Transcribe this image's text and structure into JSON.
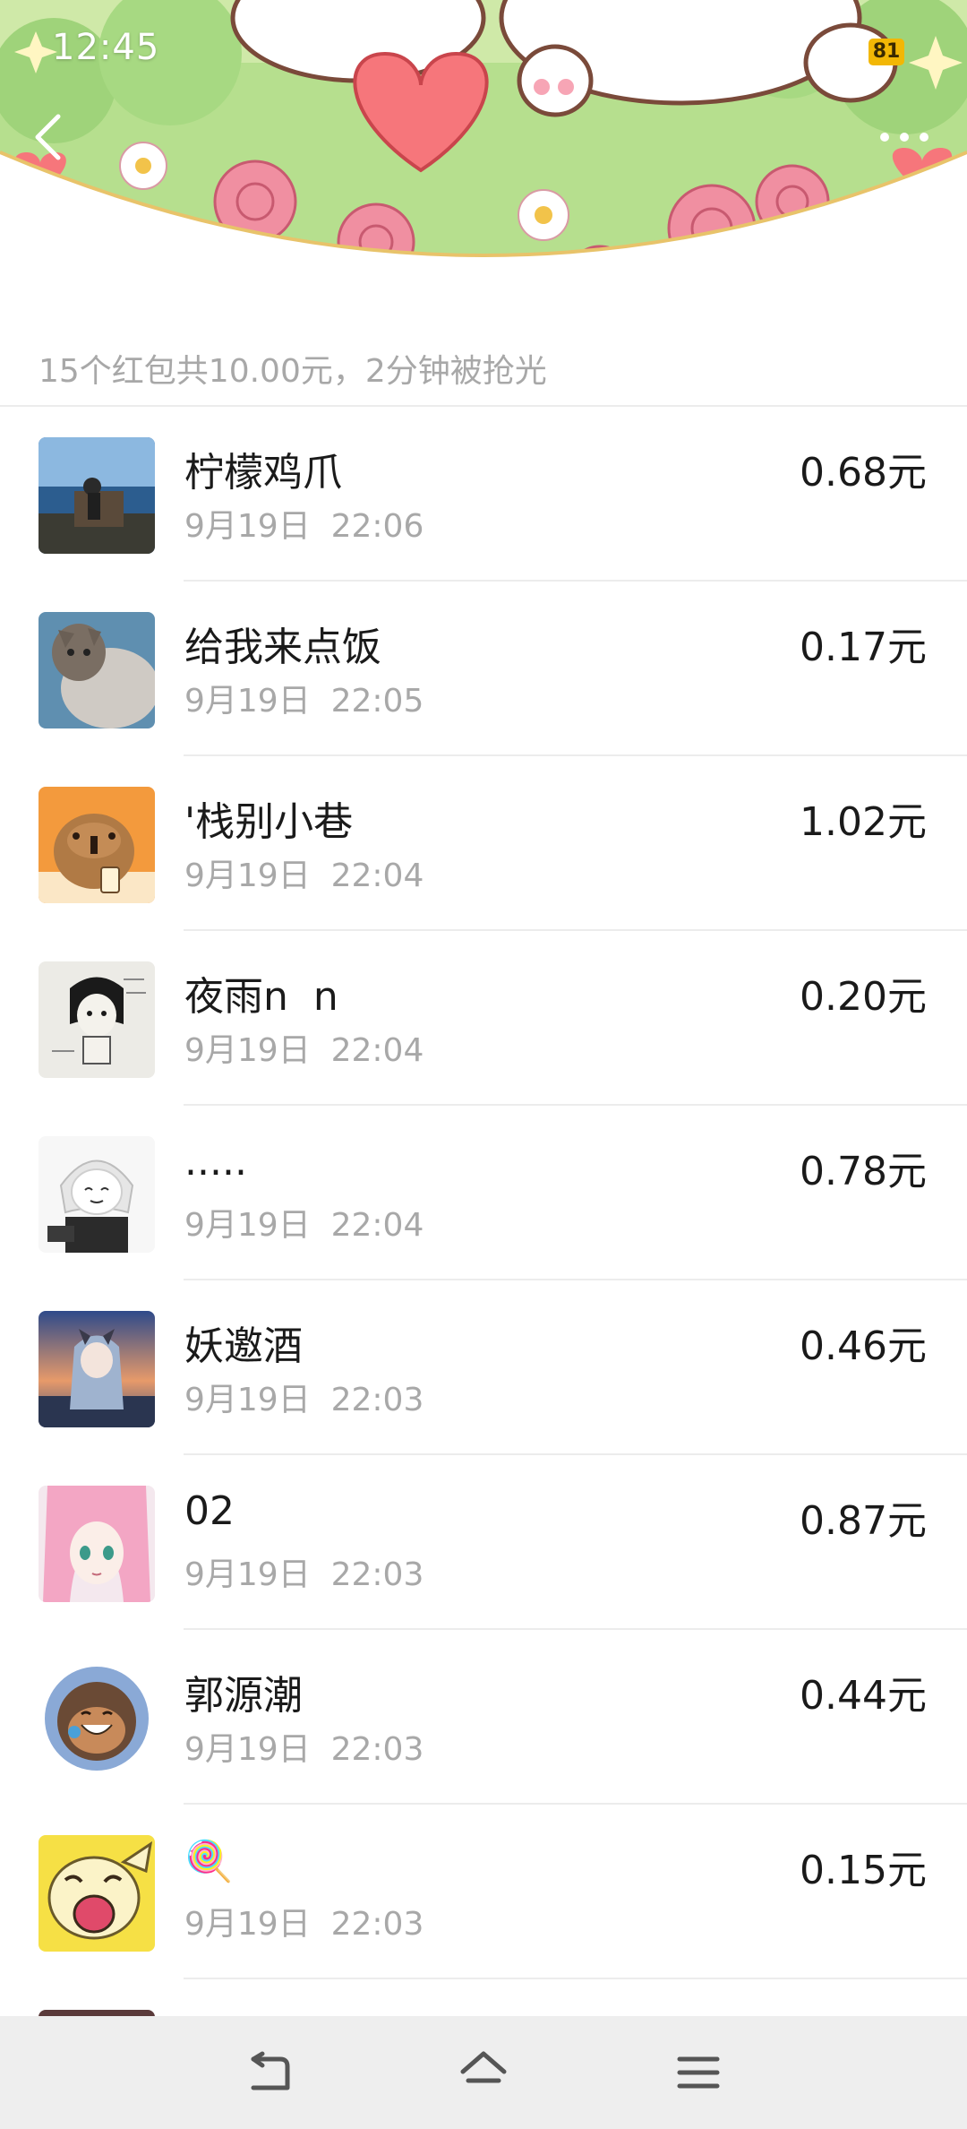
{
  "status_bar": {
    "time": "12:45",
    "battery": "81"
  },
  "summary": {
    "text": "15个红包共10.00元，2分钟被抢光"
  },
  "records": [
    {
      "name": "柠檬鸡爪",
      "time": "9月19日  22:06",
      "amount": "0.68元",
      "avatar": "photo-avatar"
    },
    {
      "name": "给我来点饭",
      "time": "9月19日  22:05",
      "amount": "0.17元",
      "avatar": "cat-avatar"
    },
    {
      "name": "'栈别小巷",
      "time": "9月19日  22:04",
      "amount": "1.02元",
      "avatar": "capybara-avatar"
    },
    {
      "name": "夜雨n  n",
      "time": "9月19日  22:04",
      "amount": "0.20元",
      "avatar": "sketch-avatar"
    },
    {
      "name": ".....",
      "time": "9月19日  22:04",
      "amount": "0.78元",
      "avatar": "white-hair-avatar"
    },
    {
      "name": "妖邀酒",
      "time": "9月19日  22:03",
      "amount": "0.46元",
      "avatar": "anime-girl-avatar"
    },
    {
      "name": "02",
      "time": "9月19日  22:03",
      "amount": "0.87元",
      "avatar": "pink-hair-avatar"
    },
    {
      "name": "郭源潮",
      "time": "9月19日  22:03",
      "amount": "0.44元",
      "avatar": "cartoon-avatar"
    },
    {
      "name": "🍭",
      "time": "9月19日  22:03",
      "amount": "0.15元",
      "avatar": "yellow-cartoon-avatar"
    }
  ]
}
